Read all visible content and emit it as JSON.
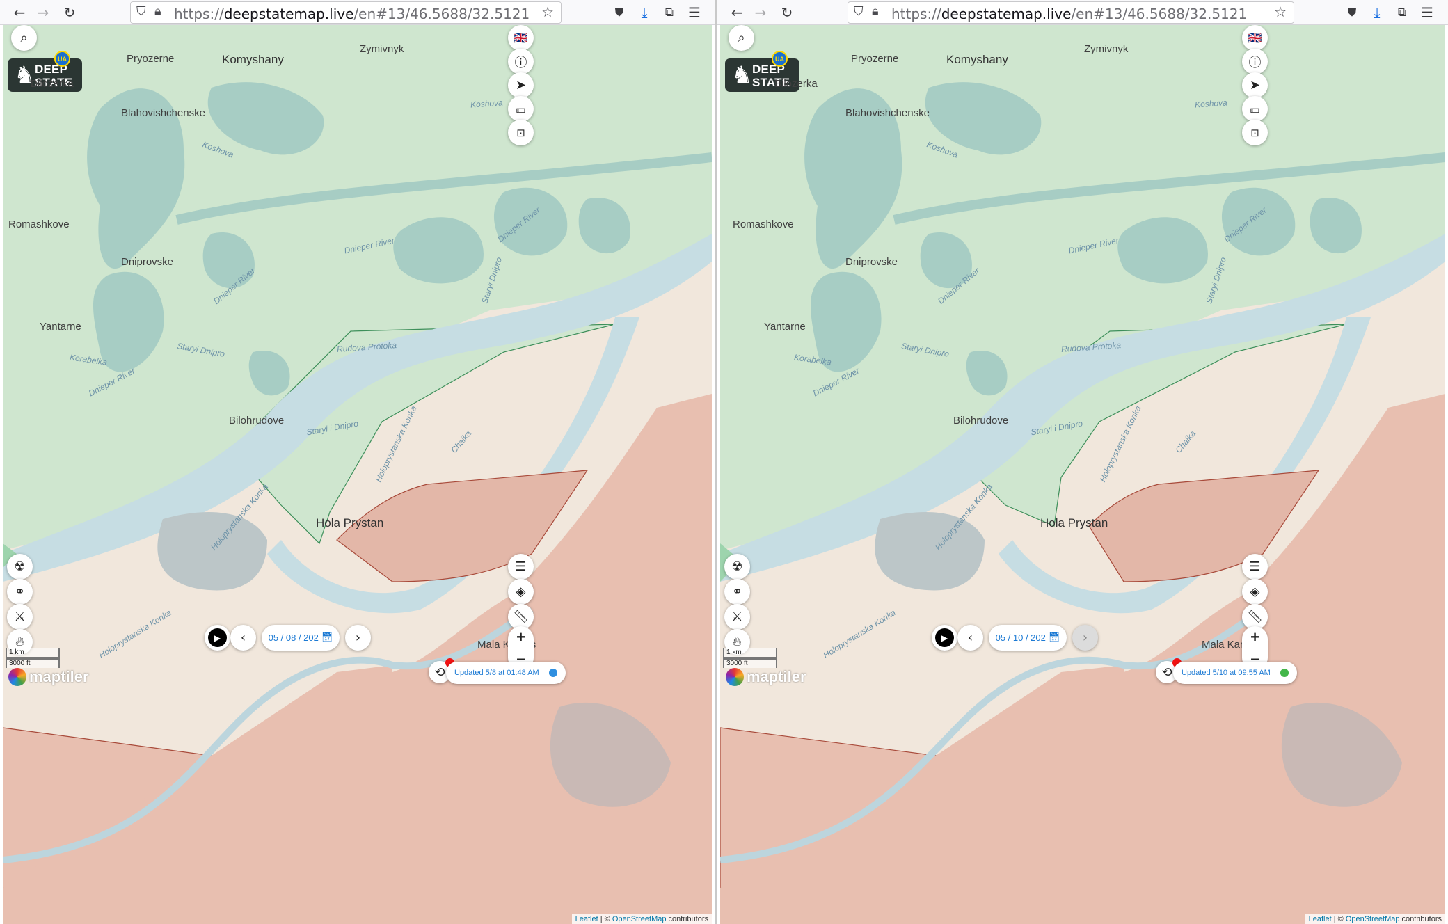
{
  "panes": [
    {
      "url_prefix": "https://",
      "url_host": "deepstatemap.live",
      "url_path": "/en#13/46.5688/32.5121",
      "date_value": "05 / 08 / 202",
      "updated_text": "Updated 5/8 at 01:48 AM",
      "status_color": "#2f8fe0"
    },
    {
      "url_prefix": "https://",
      "url_host": "deepstatemap.live",
      "url_path": "/en#13/46.5688/32.5121",
      "date_value": "05 / 10 / 202",
      "updated_text": "Updated 5/10 at 09:55 AM",
      "status_color": "#43b649"
    }
  ],
  "logo": {
    "line1": "DEEP",
    "line2": "STATE",
    "badge": "UA"
  },
  "places": {
    "pryozerne": "Pryozerne",
    "komyshany": "Komyshany",
    "zymivnyk": "Zymivnyk",
    "bilozerka": "Bilozerka",
    "blahovishchenske": "Blahovishchenske",
    "romashkove": "Romashkove",
    "dniprovske": "Dniprovske",
    "yantarne": "Yantarne",
    "bilohrudove": "Bilohrudove",
    "hola_prystan": "Hola Prystan",
    "mala_kardashynka_left": "Mala Kardas",
    "mala_kardashynka_right": "Mala Kardash"
  },
  "water": {
    "koshova": "Koshova",
    "dnieper_river": "Dnieper River",
    "staryi_dnipro": "Staryi Dnipro",
    "staryi_i_dnipro": "Staryi i Dnipro",
    "rudova_protoka": "Rudova Protoka",
    "korabelka": "Korabelka",
    "holoprystanska_konka": "Holoprystanska Konka",
    "chaika": "Chaika"
  },
  "scale": {
    "km": "1 km",
    "ft": "3000 ft"
  },
  "attribution": {
    "leaflet": "Leaflet",
    "sep": " | © ",
    "osm": "OpenStreetMap",
    "tail": " contributors"
  },
  "maptiler": "maptiler",
  "colors": {
    "liberated_green": "#cfe6cf",
    "occupied_red": "#e8bfb0",
    "contested_beige": "#f1e7dc",
    "river_blue": "#c6dde3"
  }
}
